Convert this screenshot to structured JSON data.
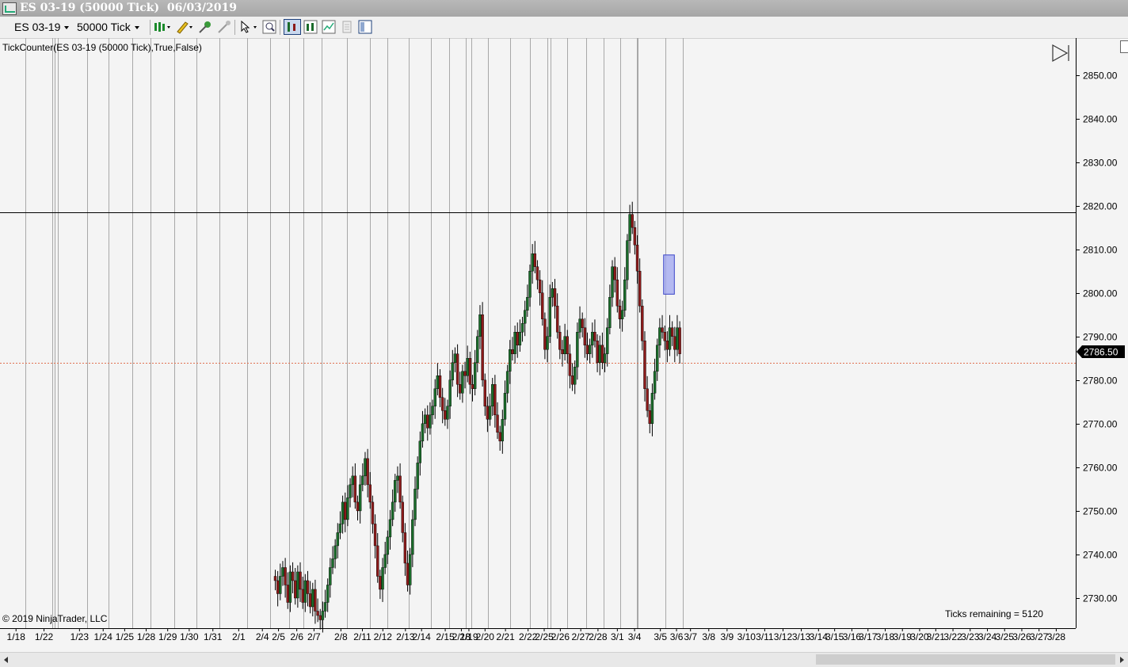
{
  "window": {
    "title": "ES 03-19 (50000 Tick)  06/03/2019"
  },
  "toolbar": {
    "instrument": "ES 03-19",
    "interval": "50000 Tick",
    "icons": [
      "candlestick-style-icon",
      "draw-pencil-icon",
      "draw-tools-icon",
      "pointer-icon",
      "zoom-icon",
      "data-series-icon",
      "indicators-icon",
      "strategies-icon",
      "properties-icon",
      "templates-icon"
    ]
  },
  "chart_header": {
    "indicator": "TickCounter(ES  03-19 (50000  Tick),True,False)"
  },
  "footer": {
    "copyright": "© 2019 NinjaTrader, LLC",
    "ticks_remaining": "Ticks remaining = 5120"
  },
  "colors": {
    "up_bar": "#1a6b2a",
    "down_bar": "#8b1a1a",
    "session_line": "#a8a8a8",
    "hline": "#000000",
    "last_price_line": "#e07050",
    "highlight_box": "#9fa5f0"
  },
  "chart_data": {
    "type": "candlestick",
    "ylim": [
      2724,
      2857
    ],
    "y_ticks": [
      "2850.00",
      "2840.00",
      "2830.00",
      "2820.00",
      "2810.00",
      "2800.00",
      "2790.00",
      "2780.00",
      "2770.00",
      "2760.00",
      "2750.00",
      "2740.00",
      "2730.00"
    ],
    "y_tick_values": [
      2850,
      2840,
      2830,
      2820,
      2810,
      2800,
      2790,
      2780,
      2770,
      2760,
      2750,
      2740,
      2730
    ],
    "last_price": {
      "label": "2786.50",
      "value": 2786.5
    },
    "horizontal_line": 2818.5,
    "price_line": 2784,
    "x_labels": [
      {
        "t": "1/18",
        "x": 0.9
      },
      {
        "t": "1/22",
        "x": 3.5
      },
      {
        "t": "1/23",
        "x": 6.8
      },
      {
        "t": "1/24",
        "x": 9.0
      },
      {
        "t": "1/25",
        "x": 11.0
      },
      {
        "t": "1/28",
        "x": 13.0
      },
      {
        "t": "1/29",
        "x": 15.0
      },
      {
        "t": "1/30",
        "x": 17.0
      },
      {
        "t": "1/31",
        "x": 19.2
      },
      {
        "t": "2/1",
        "x": 21.6
      },
      {
        "t": "2/4",
        "x": 23.8
      },
      {
        "t": "2/5",
        "x": 25.3
      },
      {
        "t": "2/6",
        "x": 27.0
      },
      {
        "t": "2/7",
        "x": 28.6
      },
      {
        "t": "2/8",
        "x": 31.1
      },
      {
        "t": "2/11",
        "x": 33.1
      },
      {
        "t": "2/12",
        "x": 35.0
      },
      {
        "t": "2/13",
        "x": 37.1
      },
      {
        "t": "2/14",
        "x": 38.6
      },
      {
        "t": "2/15",
        "x": 40.8
      },
      {
        "t": "2/18",
        "x": 42.3
      },
      {
        "t": "2/19",
        "x": 43.0
      },
      {
        "t": "2/20",
        "x": 44.5
      },
      {
        "t": "2/21",
        "x": 46.4
      },
      {
        "t": "2/22",
        "x": 48.5
      },
      {
        "t": "2/25",
        "x": 50.0
      },
      {
        "t": "2/26",
        "x": 51.5
      },
      {
        "t": "2/27",
        "x": 53.4
      },
      {
        "t": "2/28",
        "x": 55.0
      },
      {
        "t": "3/1",
        "x": 56.8
      },
      {
        "t": "3/4",
        "x": 58.4
      },
      {
        "t": "3/5",
        "x": 60.8
      },
      {
        "t": "3/6",
        "x": 62.3
      },
      {
        "t": "3/7",
        "x": 63.6
      },
      {
        "t": "3/8",
        "x": 65.3
      },
      {
        "t": "3/9",
        "x": 67.0
      },
      {
        "t": "3/10",
        "x": 68.8
      },
      {
        "t": "3/11",
        "x": 70.5
      },
      {
        "t": "3/12",
        "x": 72.2
      },
      {
        "t": "3/13",
        "x": 73.9
      },
      {
        "t": "3/14",
        "x": 75.5
      },
      {
        "t": "3/15",
        "x": 77.0
      },
      {
        "t": "3/16",
        "x": 78.6
      },
      {
        "t": "3/17",
        "x": 80.1
      },
      {
        "t": "3/18",
        "x": 81.7
      },
      {
        "t": "3/19",
        "x": 83.3
      },
      {
        "t": "3/20",
        "x": 84.9
      },
      {
        "t": "3/21",
        "x": 86.4
      },
      {
        "t": "3/22",
        "x": 88.0
      },
      {
        "t": "3/23",
        "x": 89.6
      },
      {
        "t": "3/24",
        "x": 91.2
      },
      {
        "t": "3/25",
        "x": 92.8
      },
      {
        "t": "3/26",
        "x": 94.4
      },
      {
        "t": "3/27",
        "x": 96.0
      },
      {
        "t": "3/28",
        "x": 97.6
      }
    ],
    "session_breaks": [
      1.8,
      4.3,
      4.5,
      4.8,
      7.5,
      9.5,
      11.7,
      13.4,
      15.6,
      17.7,
      19.8,
      22.4,
      24.5,
      26.3,
      27.6,
      29.3,
      31.7,
      33.8,
      35.4,
      37.4,
      39.5,
      41.2,
      42.7,
      43.2,
      44.8,
      46.8,
      48.7,
      50.3,
      50.6,
      52.1,
      53.9,
      55.5,
      57.1,
      58.6,
      58.7,
      61.3,
      62.9
    ],
    "highlight_box": {
      "x": [
        61.1,
        62.1
      ],
      "y": [
        2799.7,
        2808.7
      ]
    },
    "series": [
      {
        "name": "ES 03-19",
        "closes": [
          2734,
          2731,
          2735,
          2737,
          2733,
          2729,
          2736,
          2734,
          2730,
          2736,
          2732,
          2729,
          2734,
          2731,
          2728,
          2732,
          2727,
          2726,
          2725,
          2727,
          2729,
          2733,
          2737,
          2739,
          2742,
          2745,
          2747,
          2752,
          2748,
          2753,
          2756,
          2758,
          2752,
          2750,
          2756,
          2758,
          2762,
          2756,
          2752,
          2747,
          2742,
          2735,
          2732,
          2737,
          2740,
          2744,
          2748,
          2752,
          2757,
          2758,
          2752,
          2745,
          2738,
          2733,
          2740,
          2748,
          2755,
          2761,
          2766,
          2770,
          2772,
          2769,
          2772,
          2774,
          2778,
          2781,
          2776,
          2773,
          2771,
          2774,
          2780,
          2784,
          2786,
          2779,
          2777,
          2782,
          2781,
          2785,
          2779,
          2778,
          2784,
          2790,
          2795,
          2780,
          2774,
          2771,
          2774,
          2779,
          2772,
          2768,
          2766,
          2771,
          2777,
          2782,
          2787,
          2786,
          2791,
          2788,
          2791,
          2793,
          2796,
          2799,
          2805,
          2809,
          2806,
          2803,
          2800,
          2794,
          2787,
          2790,
          2799,
          2801,
          2797,
          2791,
          2787,
          2786,
          2790,
          2786,
          2781,
          2779,
          2783,
          2791,
          2794,
          2792,
          2788,
          2786,
          2788,
          2791,
          2789,
          2784,
          2788,
          2784,
          2786,
          2792,
          2799,
          2806,
          2803,
          2797,
          2794,
          2796,
          2803,
          2812,
          2818,
          2815,
          2811,
          2805,
          2797,
          2789,
          2778,
          2773,
          2770,
          2777,
          2782,
          2788,
          2792,
          2791,
          2789,
          2787,
          2792,
          2790,
          2787,
          2792,
          2786
        ]
      }
    ]
  }
}
